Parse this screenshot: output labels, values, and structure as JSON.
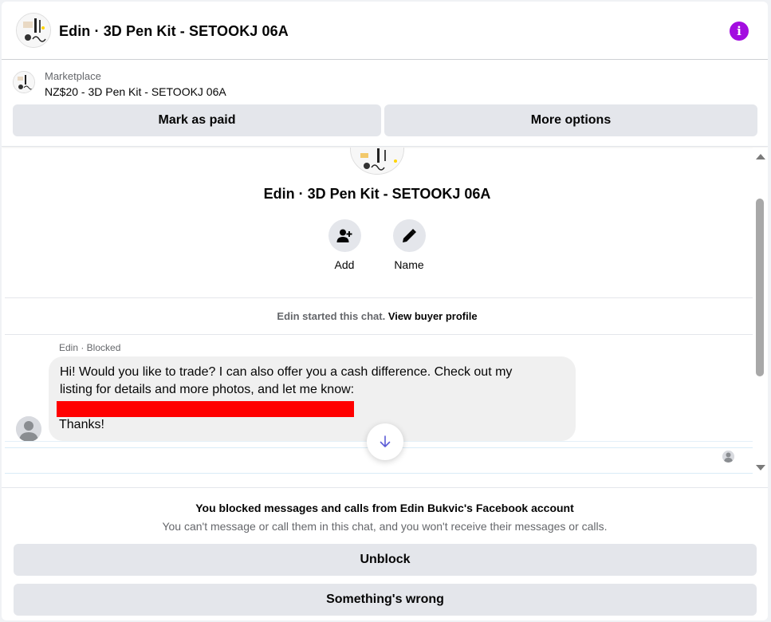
{
  "header": {
    "title": "Edin · 3D Pen Kit - SETOOKJ 06A",
    "info_icon": "info-icon",
    "info_symbol": "i",
    "accent": "#a30de0"
  },
  "marketplace": {
    "label": "Marketplace",
    "item": "NZ$20 - 3D Pen Kit - SETOOKJ 06A",
    "mark_paid": "Mark as paid",
    "more_options": "More options"
  },
  "conversation": {
    "title": "Edin · 3D Pen Kit - SETOOKJ 06A",
    "actions": [
      {
        "label": "Add",
        "icon": "add-person-icon"
      },
      {
        "label": "Name",
        "icon": "pencil-icon"
      }
    ],
    "started_text": "Edin started this chat.",
    "view_profile": "View buyer profile",
    "sender": "Edin · Blocked",
    "message_line1": "Hi! Would you like to trade? I can also offer you a cash difference. Check out my",
    "message_line2": "listing for details and more photos, and let me know:",
    "message_redacted": true,
    "message_thanks": "Thanks!",
    "scroll_down_icon": "arrow-down-icon"
  },
  "footer": {
    "blocked_title": "You blocked messages and calls from Edin Bukvic's Facebook account",
    "blocked_sub": "You can't message or call them in this chat, and you won't receive their messages or calls.",
    "unblock": "Unblock",
    "something_wrong": "Something's wrong"
  }
}
